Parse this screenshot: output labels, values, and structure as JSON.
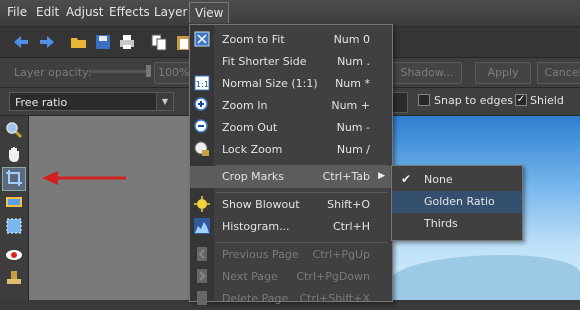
{
  "menubar": {
    "items": [
      {
        "label": "File"
      },
      {
        "label": "Edit"
      },
      {
        "label": "Adjust"
      },
      {
        "label": "Effects"
      },
      {
        "label": "Layer"
      },
      {
        "label": "View"
      }
    ]
  },
  "options_row": {
    "layer_opacity_label": "Layer opacity:",
    "opacity_value": "100%",
    "shadow_button": "Shadow...",
    "apply_button": "Apply",
    "cancel_button": "Cancel"
  },
  "crop_row": {
    "ratio_select": "Free ratio",
    "snap_to_edges": {
      "label": "Snap to edges",
      "checked": false
    },
    "shield": {
      "label": "Shield",
      "checked": true
    }
  },
  "view_menu": {
    "items": [
      {
        "label": "Zoom to Fit",
        "shortcut": "Num 0",
        "icon": "zoom-fit-icon",
        "enabled": true
      },
      {
        "label": "Fit Shorter Side",
        "shortcut": "Num .",
        "icon": "",
        "enabled": true
      },
      {
        "label": "Normal Size (1:1)",
        "shortcut": "Num *",
        "icon": "actual-size-icon",
        "enabled": true
      },
      {
        "label": "Zoom In",
        "shortcut": "Num +",
        "icon": "zoom-in-icon",
        "enabled": true
      },
      {
        "label": "Zoom Out",
        "shortcut": "Num -",
        "icon": "zoom-out-icon",
        "enabled": true
      },
      {
        "label": "Lock Zoom",
        "shortcut": "Num /",
        "icon": "lock-zoom-icon",
        "enabled": true
      },
      {
        "label": "Crop Marks",
        "shortcut": "Ctrl+Tab",
        "icon": "",
        "enabled": true,
        "highlighted": true,
        "has_submenu": true
      },
      {
        "label": "Show Blowout",
        "shortcut": "Shift+O",
        "icon": "blowout-icon",
        "enabled": true
      },
      {
        "label": "Histogram...",
        "shortcut": "Ctrl+H",
        "icon": "histogram-icon",
        "enabled": true
      },
      {
        "label": "Previous Page",
        "shortcut": "Ctrl+PgUp",
        "icon": "previous-page-icon",
        "enabled": false
      },
      {
        "label": "Next Page",
        "shortcut": "Ctrl+PgDown",
        "icon": "next-page-icon",
        "enabled": false
      },
      {
        "label": "Delete Page",
        "shortcut": "Ctrl+Shift+X",
        "icon": "delete-page-icon",
        "enabled": false
      }
    ]
  },
  "crop_marks_submenu": {
    "items": [
      {
        "label": "None",
        "checked": true
      },
      {
        "label": "Golden Ratio",
        "highlighted": true
      },
      {
        "label": "Thirds"
      }
    ]
  },
  "colors": {
    "menu_bg": "#404040",
    "highlight": "#5c5c5c",
    "submenu_highlight": "#34506e",
    "annotation_arrow": "#d42020"
  }
}
